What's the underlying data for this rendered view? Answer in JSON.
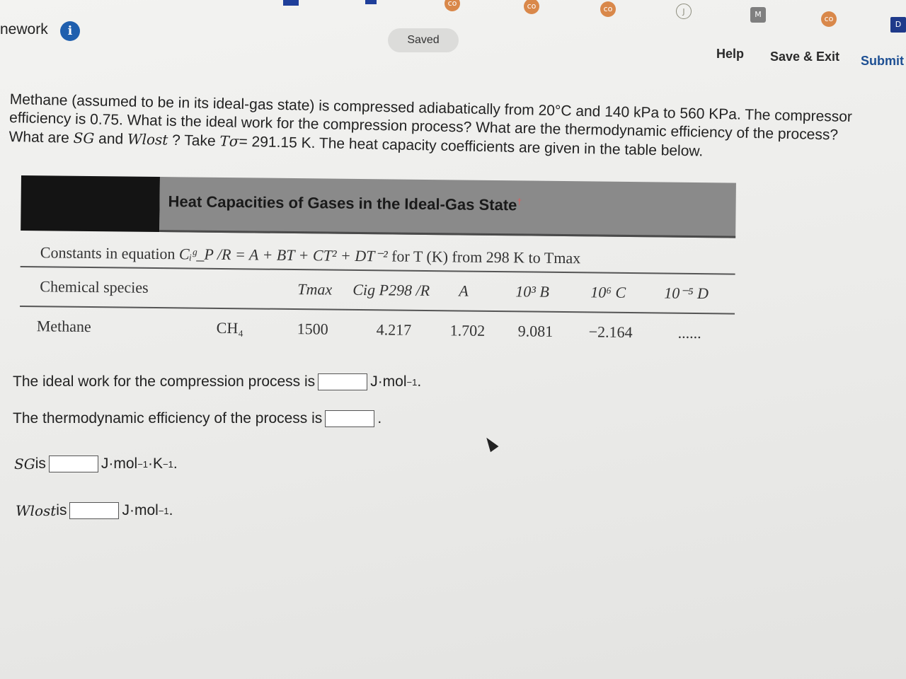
{
  "header": {
    "title": "nework",
    "saved_label": "Saved",
    "help_label": "Help",
    "save_exit_label": "Save & Exit",
    "submit_label": "Submit",
    "tab_icons": [
      "co",
      "co",
      "co",
      "co",
      "J",
      "M",
      "co",
      "D"
    ]
  },
  "question": {
    "line1": "Methane (assumed to be in its ideal-gas state) is compressed adiabatically from 20°C and 140 kPa to 560 KPa. The compressor",
    "line2": "efficiency is 0.75. What is the ideal work for the compression process? What are the thermodynamic efficiency of the process?",
    "line3a": "What are ",
    "sg": "SG",
    "line3b": " and ",
    "wlost": "Wlost",
    "line3c": " ? Take ",
    "tsigma": "Tσ",
    "line3d": "= 291.15 K. The heat capacity coefficients are given in the table below."
  },
  "table": {
    "title": "Heat Capacities of Gases in the Ideal-Gas State",
    "title_mark": "†",
    "equation_prefix": "Constants in equation ",
    "equation": "Cᵢᵍ_P /R = A + BT + CT² + DT⁻²",
    "equation_suffix": " for T (K) from 298 K to Tmax",
    "columns": [
      "Chemical species",
      "Tmax",
      "Cig P298 /R",
      "A",
      "10³ B",
      "10⁶ C",
      "10⁻⁵ D"
    ],
    "row": {
      "name": "Methane",
      "formula": "CH₄",
      "tmax": "1500",
      "cp298": "4.217",
      "a": "1.702",
      "b": "9.081",
      "c": "−2.164",
      "d": "......"
    }
  },
  "answers": {
    "ideal_work_prompt": "The ideal work for the compression process is",
    "ideal_work_unit": "J·mol",
    "ideal_work_unit_exp": "−1",
    "efficiency_prompt": "The thermodynamic efficiency of the process is",
    "sg_label": "SG",
    "sg_is": " is",
    "sg_unit": "J·mol",
    "sg_unit_exp1": "−1",
    "sg_unit_k": "·K",
    "sg_unit_exp2": "−1",
    "wlost_label": "Wlost",
    "wlost_is": " is",
    "wlost_unit": "J·mol",
    "wlost_unit_exp": "−1"
  }
}
